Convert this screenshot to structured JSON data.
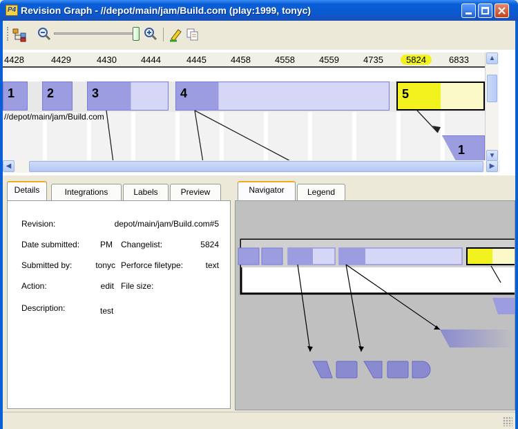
{
  "window": {
    "title": "Revision Graph - //depot/main/jam/Build.com (play:1999, tonyc)",
    "app_icon_text": "P4"
  },
  "colors": {
    "accent_yellow": "#f2f21e",
    "node_blue": "#9c9ce0",
    "node_light": "#d6d6f6",
    "titlebar": "#0a5fd6"
  },
  "toolbar": {
    "icons": [
      "layout-icon",
      "zoom-out-icon",
      "zoom-slider",
      "zoom-in-icon",
      "highlight-icon",
      "copy-icon"
    ],
    "zoom_level": 0.95
  },
  "revisions": [
    "4428",
    "4429",
    "4430",
    "4444",
    "4445",
    "4458",
    "4558",
    "4559",
    "4735",
    "5824",
    "6833"
  ],
  "selected_revision": "5824",
  "graph": {
    "nodes": [
      "1",
      "2",
      "3",
      "4",
      "5"
    ],
    "branch_node": "1",
    "path_label": "//depot/main/jam/Build.com"
  },
  "left_tabs": [
    "Details",
    "Integrations",
    "Labels",
    "Preview"
  ],
  "right_tabs": [
    "Navigator",
    "Legend"
  ],
  "details": {
    "revision_label": "Revision:",
    "revision_value": "depot/main/jam/Build.com#5",
    "date_label": "Date submitted:",
    "date_value": "PM",
    "changelist_label": "Changelist:",
    "changelist_value": "5824",
    "submitted_label": "Submitted by:",
    "submitted_value": "tonyc",
    "filetype_label": "Perforce filetype:",
    "filetype_value": "text",
    "action_label": "Action:",
    "action_value": "edit",
    "filesize_label": "File size:",
    "filesize_value": "",
    "description_label": "Description:",
    "description_value": "test"
  }
}
